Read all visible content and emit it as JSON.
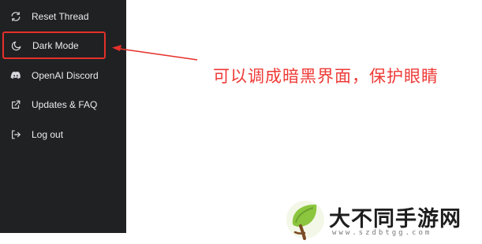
{
  "sidebar": {
    "items": [
      {
        "label": "Reset Thread",
        "icon": "refresh-icon"
      },
      {
        "label": "Dark Mode",
        "icon": "moon-icon"
      },
      {
        "label": "OpenAI Discord",
        "icon": "discord-icon"
      },
      {
        "label": "Updates & FAQ",
        "icon": "external-link-icon"
      },
      {
        "label": "Log out",
        "icon": "logout-icon"
      }
    ]
  },
  "annotation": {
    "text": "可以调成暗黑界面，保护眼睛",
    "color": "#ee3a36"
  },
  "watermark": {
    "title": "大不同手游网",
    "url": "www.szdbtgg.com"
  },
  "colors": {
    "sidebar_bg": "#202123",
    "highlight": "#e5302a"
  }
}
